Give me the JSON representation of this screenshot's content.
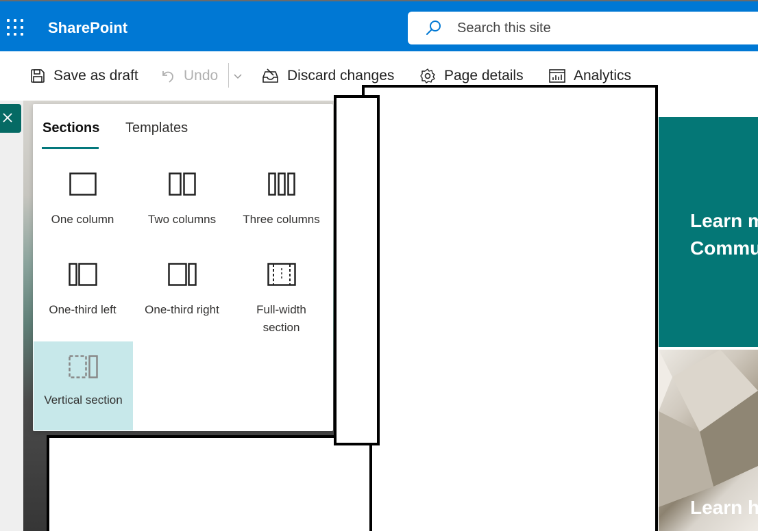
{
  "suite": {
    "brand": "SharePoint",
    "search_placeholder": "Search this site"
  },
  "commands": {
    "save_draft": "Save as draft",
    "undo": "Undo",
    "discard": "Discard changes",
    "page_details": "Page details",
    "analytics": "Analytics"
  },
  "panel": {
    "tabs": [
      "Sections",
      "Templates"
    ],
    "active_tab": "Sections",
    "layouts": [
      {
        "label": "One column",
        "icon": "one-column-icon"
      },
      {
        "label": "Two columns",
        "icon": "two-columns-icon"
      },
      {
        "label": "Three columns",
        "icon": "three-columns-icon"
      },
      {
        "label": "One-third left",
        "icon": "one-third-left-icon"
      },
      {
        "label": "One-third right",
        "icon": "one-third-right-icon"
      },
      {
        "label": "Full-width section",
        "icon": "full-width-icon"
      },
      {
        "label": "Vertical section",
        "icon": "vertical-section-icon",
        "selected": true
      }
    ]
  },
  "tiles": {
    "teal_text": "Learn m\nCommu",
    "image_text": "Learn h\nweb pa"
  },
  "colors": {
    "suite_bar": "#0078d4",
    "accent_teal": "#03787c",
    "selected_bg": "#c7e8ea"
  }
}
